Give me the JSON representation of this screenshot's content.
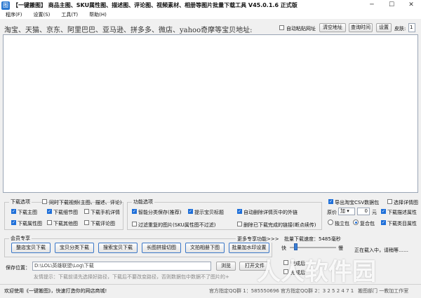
{
  "window": {
    "title": "【一键搬图】 商品主图、SKU属性图、描述图、评论图、视频素材、相册等图片批量下载工具 V45.0.1.6 正式版",
    "app_icon_text": "图",
    "minimize": "─",
    "maximize": "☐",
    "close": "✕"
  },
  "menu": [
    "程序(F)",
    "设置(S)",
    "工具(T)",
    "帮助(H)"
  ],
  "url_bar": {
    "label": "淘宝、天猫、京东、阿里巴巴、亚马逊、拼多多、微店、yahoo奇摩等宝贝地址:",
    "auto_paste_label": "自动粘贴网址",
    "auto_paste_checked": false,
    "clear_button": "清空地址",
    "query_time_button": "查询时间",
    "settings_button": "设置",
    "skin_label": "皮肤:",
    "skin_value": "1"
  },
  "download_options": {
    "title": "下载选项",
    "sync_video_label": "同时下载视频(主图、描述、评论)",
    "sync_video_checked": false,
    "items": [
      {
        "label": "下载主图",
        "checked": true
      },
      {
        "label": "下载细节图",
        "checked": true
      },
      {
        "label": "下载手机详情",
        "checked": false
      },
      {
        "label": "下载属性图",
        "checked": true
      },
      {
        "label": "下载其他图",
        "checked": false
      },
      {
        "label": "下载评论图",
        "checked": false
      }
    ]
  },
  "function_options": {
    "title": "功能选项",
    "items": [
      {
        "label": "智能分类保存(推荐)",
        "checked": true
      },
      {
        "label": "提示宝贝标题",
        "checked": true
      },
      {
        "label": "自动删除详情页中的外链",
        "checked": true
      },
      {
        "label": "过滤重复的图片(SKU属性图不过滤)",
        "checked": false
      },
      {
        "label": "删除已下载完成的链接(断点续传)",
        "checked": false
      }
    ]
  },
  "right_options": {
    "export_csv_label": "导出淘宝CSV数据包",
    "export_csv_checked": true,
    "select_detail_label": "选择详情图",
    "select_detail_checked": false,
    "price_label": "原价",
    "price_op": "加",
    "price_value": "0",
    "price_unit": "元",
    "download_desc_attr_label": "下载描述属性",
    "download_desc_attr_checked": true,
    "independent_label": "独立包",
    "independent_checked": false,
    "composite_label": "复合包",
    "composite_checked": true,
    "download_category_label": "下载类目属性",
    "download_category_checked": true
  },
  "member_section": {
    "title": "会员专享",
    "more_label": "更多专享功能>>>",
    "buttons": [
      "整店宝贝下载",
      "宝贝分类下载",
      "搜索宝贝下载",
      "长图拼接切图",
      "文拍相册下图",
      "批量加水印设置"
    ]
  },
  "speed": {
    "title": "批量下载速度：5485毫秒",
    "fast_label": "快",
    "slow_label": "慢",
    "level": 0.12
  },
  "status_panel": {
    "loading_text": "正在载入中，请稍等……"
  },
  "save": {
    "label": "保存位置：",
    "path": "D:\\LOL\\英雄联盟\\Log\\下载",
    "browse_button": "浏览",
    "open_folder_button": "打开文件",
    "hint": "友情提示：下载前请先选择好路径，下载后不要改变路径，否则数据包中数据不了图片的+",
    "after_complete_1": "完成后",
    "after_complete_2": "完成后"
  },
  "statusbar": {
    "welcome": "欢迎使用《一键搬图》，快速打造你的网店商城!",
    "qq_group_1": "官方指定QQ群 1：585550696",
    "qq_group_2": "官方指定QQ群 2：3 2 5 2 4 7 1",
    "alt_links": "搬图部门 一教加工作室"
  },
  "watermark": "人人软件园",
  "colors": {
    "accent": "#1e6fd9",
    "window_bg": "#f0f0f0",
    "member_button_border": "#3c78c8"
  }
}
